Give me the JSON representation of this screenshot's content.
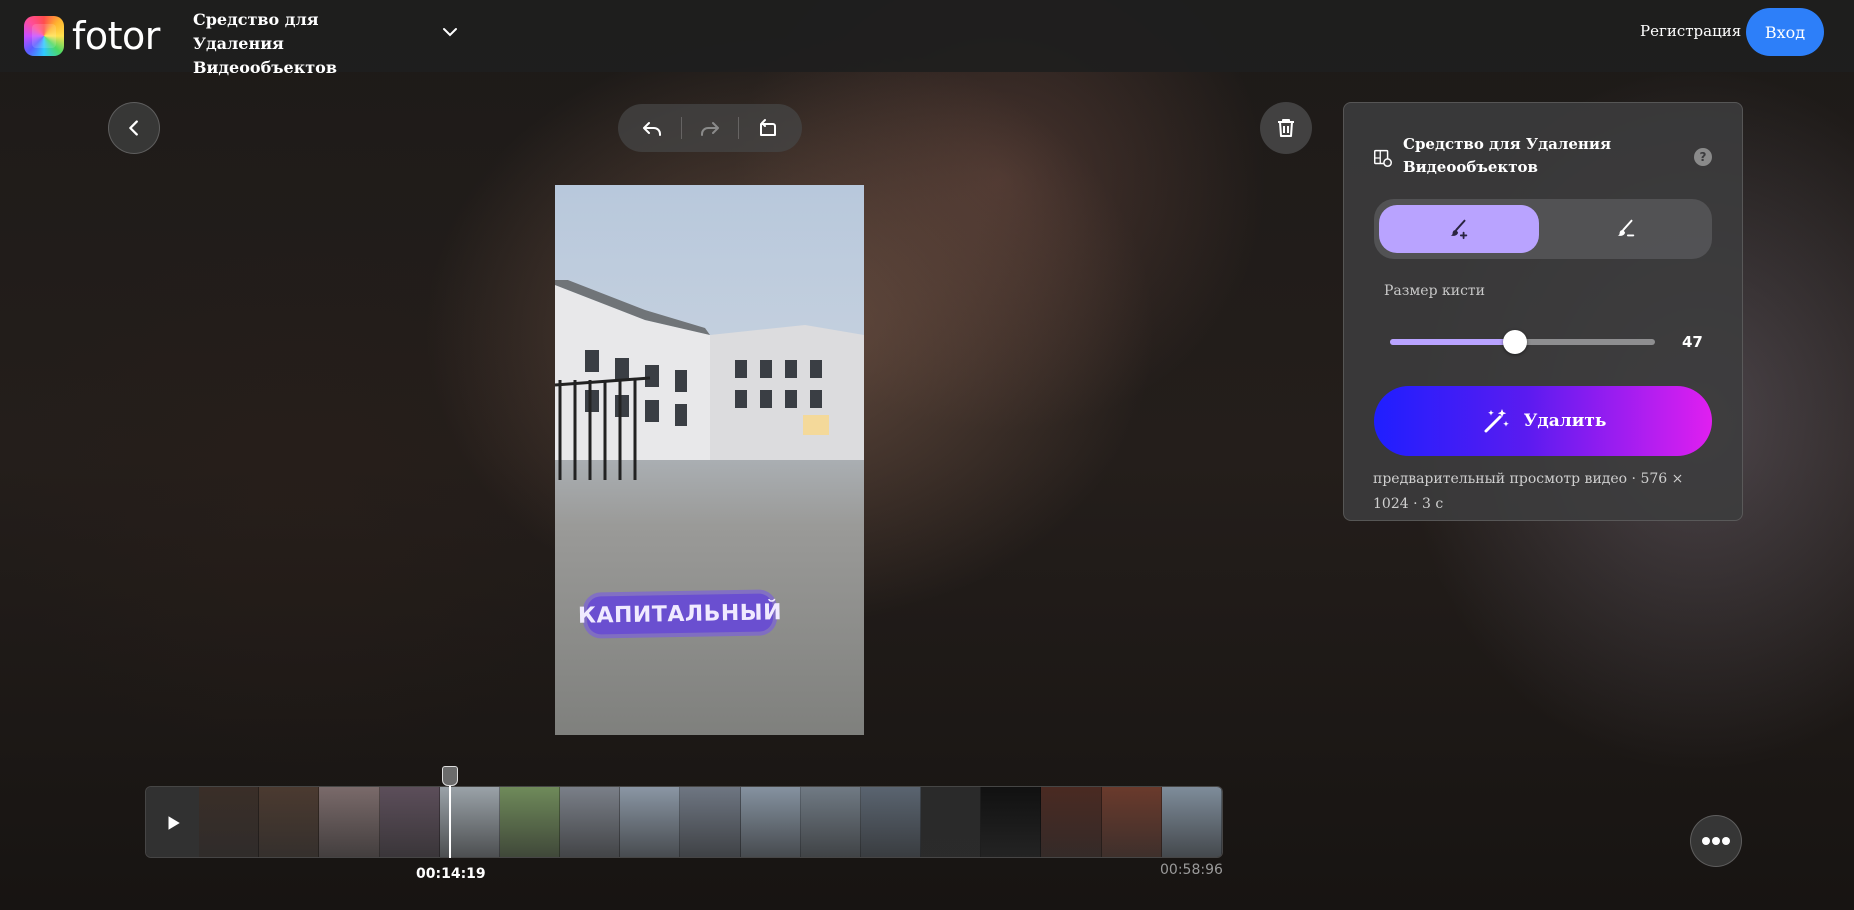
{
  "header": {
    "logo_text": "fotor",
    "tool_title": "Средство для Удаления Видеообъектов",
    "register_label": "Регистрация",
    "login_label": "Вход"
  },
  "canvas": {
    "caption_overlay": "КАПИТАЛЬНЫЙ"
  },
  "panel": {
    "title": "Средство для Удаления Видеообъектов",
    "help": "?",
    "brush_size_label": "Размер кисти",
    "brush_size_value": "47",
    "brush_size_fraction": 0.47,
    "remove_label": "Удалить",
    "preview_info": "предварительный просмотр видео · 576 × 1024 · 3 с"
  },
  "timeline": {
    "current_time": "00:14:19",
    "total_time": "00:58:96",
    "playhead_fraction": 0.2455
  },
  "colors": {
    "accent": "#b9a3ff",
    "login": "#2d7ff9",
    "remove_gradient_start": "#1f1fff",
    "remove_gradient_end": "#e01ff0"
  },
  "icons": {
    "back": "chevron-left-icon",
    "undo": "undo-icon",
    "redo": "redo-icon",
    "reset": "reset-icon",
    "trash": "trash-icon",
    "more": "more-icon",
    "play": "play-icon"
  }
}
